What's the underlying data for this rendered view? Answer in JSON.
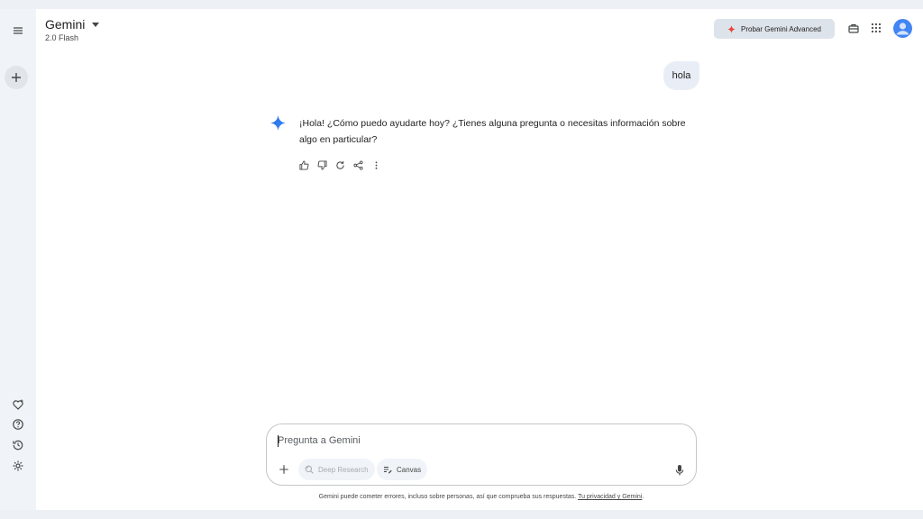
{
  "header": {
    "title": "Gemini",
    "model": "2.0 Flash",
    "advanced_button": "Probar Gemini Advanced"
  },
  "chat": {
    "user_message": "hola",
    "bot_message": "¡Hola! ¿Cómo puedo ayudarte hoy? ¿Tienes alguna pregunta o necesitas información sobre algo en particular?"
  },
  "composer": {
    "placeholder": "Pregunta a Gemini",
    "deep_research": "Deep Research",
    "canvas": "Canvas"
  },
  "footer": {
    "disclaimer": "Gemini puede cometer errores, incluso sobre personas, así que comprueba sus respuestas.",
    "privacy_link": "Tu privacidad y Gemini",
    "trailing": "."
  },
  "icons": {
    "menu": "menu-icon",
    "new_chat": "plus-icon",
    "gems": "heart-icon",
    "help": "help-icon",
    "activity": "history-icon",
    "settings": "gear-icon",
    "spark": "spark-icon",
    "apps": "apps-grid-icon",
    "mic": "mic-icon"
  },
  "colors": {
    "accent_blue": "#4285f4",
    "spark_red": "#e8453c",
    "rail_bg": "#f0f4f9",
    "bubble_bg": "#e9eef6"
  }
}
